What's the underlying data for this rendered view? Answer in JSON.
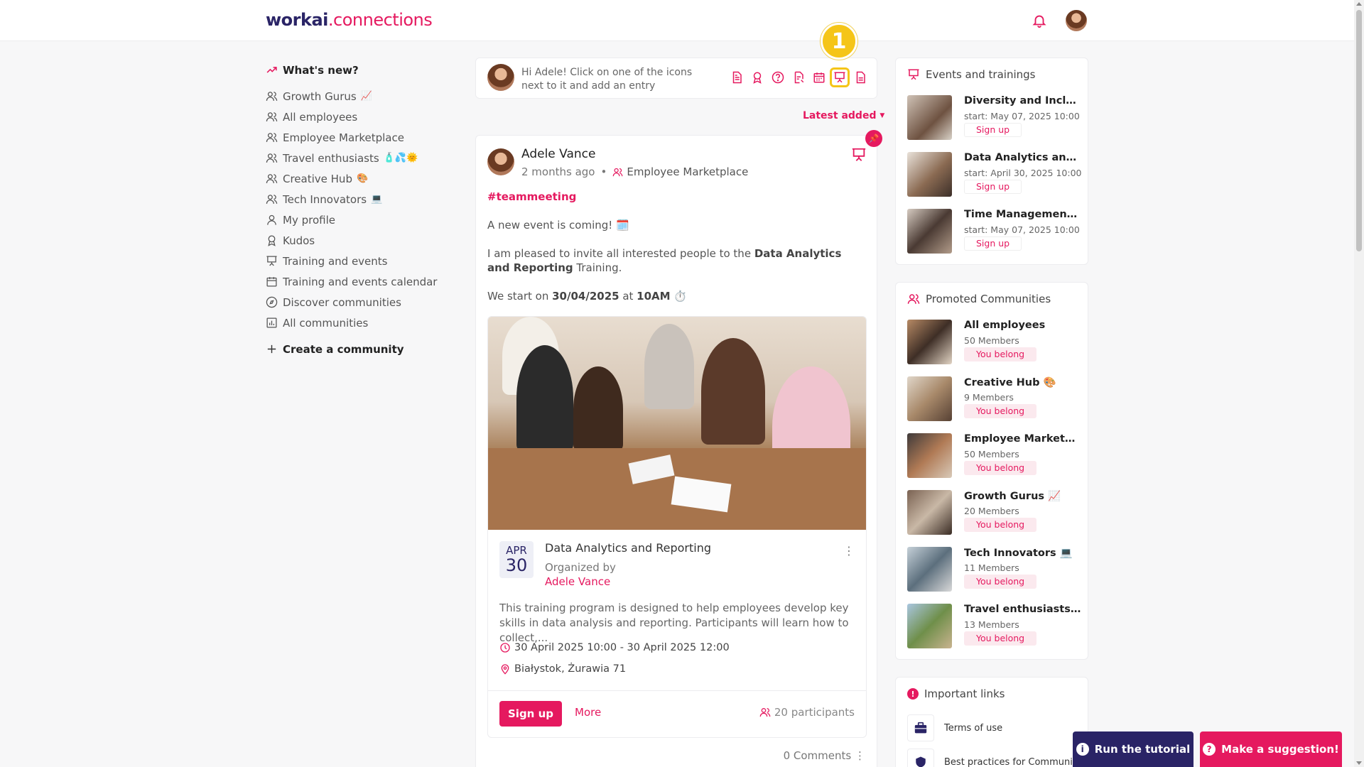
{
  "header": {
    "logo_main": "workai",
    "logo_accent": ".connections"
  },
  "sidebar": {
    "whats_new": "What's new?",
    "items": [
      {
        "label": "Growth Gurus",
        "emoji": "📈",
        "icon": "group-icon"
      },
      {
        "label": "All employees",
        "emoji": "",
        "icon": "group-icon"
      },
      {
        "label": "Employee Marketplace",
        "emoji": "",
        "icon": "group-icon"
      },
      {
        "label": "Travel enthusiasts",
        "emoji": "🧴💦🌞",
        "icon": "group-icon"
      },
      {
        "label": "Creative Hub",
        "emoji": "🎨",
        "icon": "group-icon"
      },
      {
        "label": "Tech Innovators",
        "emoji": "💻",
        "icon": "group-icon"
      },
      {
        "label": "My profile",
        "emoji": "",
        "icon": "user-icon"
      },
      {
        "label": "Kudos",
        "emoji": "",
        "icon": "award-icon"
      },
      {
        "label": "Training and events",
        "emoji": "",
        "icon": "presentation-icon"
      },
      {
        "label": "Training and events calendar",
        "emoji": "",
        "icon": "calendar-icon"
      },
      {
        "label": "Discover communities",
        "emoji": "",
        "icon": "compass-icon"
      },
      {
        "label": "All communities",
        "emoji": "",
        "icon": "chart-icon"
      }
    ],
    "create": "Create a community"
  },
  "composer": {
    "hint": "Hi Adele! Click on one of the icons next to it and add an entry",
    "step": "1"
  },
  "feed": {
    "sort_label": "Latest added"
  },
  "post": {
    "author": "Adele Vance",
    "time": "2 months ago",
    "community": "Employee Marketplace",
    "hashtag": "#teammeeting",
    "line1": "A new event is coming! 🗓️",
    "line2_pre": "I am pleased to invite all interested people to the ",
    "line2_bold": "Data Analytics and Reporting",
    "line2_post": " Training.",
    "line3_pre": "We start on ",
    "line3_date": "30/04/2025",
    "line3_mid": " at ",
    "line3_time": "10AM",
    "line3_post": " ⏱️",
    "comments": "0 Comments"
  },
  "event": {
    "month": "APR",
    "day": "30",
    "title": "Data Analytics and Reporting",
    "organized_by": "Organized by",
    "organizer": "Adele Vance",
    "description": "This training program is designed to help employees develop key skills in data analysis and reporting. Participants will learn how to collect,...",
    "time": "30 April 2025 10:00 - 30 April 2025 12:00",
    "place": "Białystok, Żurawia 71",
    "signup": "Sign up",
    "more": "More",
    "participants": "20 participants"
  },
  "events_panel": {
    "title": "Events and trainings",
    "items": [
      {
        "title": "Diversity and Inclusi...",
        "start": "start: May 07, 2025 10:00",
        "action": "Sign up"
      },
      {
        "title": "Data Analytics and ...",
        "start": "start: April 30, 2025 10:00",
        "action": "Sign up"
      },
      {
        "title": "Time Management ...",
        "start": "start: May 07, 2025 10:00",
        "action": "Sign up"
      }
    ]
  },
  "communities_panel": {
    "title": "Promoted Communities",
    "items": [
      {
        "title": "All employees",
        "members": "50 Members",
        "status": "You belong"
      },
      {
        "title": "Creative Hub 🎨",
        "members": "9 Members",
        "status": "You belong"
      },
      {
        "title": "Employee Marketpla...",
        "members": "50 Members",
        "status": "You belong"
      },
      {
        "title": "Growth Gurus 📈",
        "members": "20 Members",
        "status": "You belong"
      },
      {
        "title": "Tech Innovators 💻",
        "members": "11 Members",
        "status": "You belong"
      },
      {
        "title": "Travel enthusiasts ...",
        "members": "13 Members",
        "status": "You belong"
      }
    ]
  },
  "links_panel": {
    "title": "Important links",
    "items": [
      "Terms of use",
      "Best practices for Community"
    ]
  },
  "floating": {
    "tutorial": "Run the tutorial",
    "suggestion": "Make a suggestion!"
  },
  "colors": {
    "accent": "#e5195f",
    "navy": "#2a2466",
    "highlight": "#f5c518"
  }
}
